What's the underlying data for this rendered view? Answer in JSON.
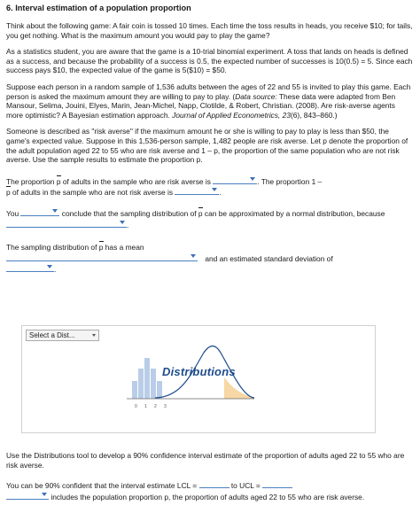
{
  "title": "6. Interval estimation of a population proportion",
  "para1": "Think about the following game: A fair coin is tossed 10 times. Each time the toss results in heads, you receive $10; for tails, you get nothing. What is the maximum amount you would pay to play the game?",
  "para2": "As a statistics student, you are aware that the game is a 10-trial binomial experiment. A toss that lands on heads is defined as a success, and because the probability of a success is 0.5, the expected number of successes is 10(0.5) = 5. Since each success pays $10, the expected value of the game is 5($10) = $50.",
  "para3a": "Suppose each person in a random sample of 1,536 adults between the ages of 22 and 55 is invited to play this game. Each person is asked the maximum amount they are willing to pay to play. (",
  "para3_source_label": "Data source:",
  "para3b": " These data were adapted from Ben Mansour, Selima, Jouini, Elyes, Marin, Jean-Michel, Napp, Clotilde, & Robert, Christian. (2008). Are risk-averse agents more optimistic? A Bayesian estimation approach. ",
  "para3_journal": "Journal of Applied Econometrics, 23",
  "para3c": "(6), 843–860.)",
  "para4": "Someone is described as \"risk averse\" if the maximum amount he or she is willing to pay to play is less than $50, the game's expected value. Suppose in this 1,536-person sample, 1,482 people are risk averse. Let p denote the proportion of the adult population aged 22 to 55 who are risk averse and 1 – p, the proportion of the same population who are not risk averse. Use the sample results to estimate the proportion p.",
  "q1_a": "The proportion",
  "q1_b": "of adults in the sample who are risk averse is",
  "q1_c": ". The proportion 1 –",
  "q1_d": "of adults in the sample who are not risk averse is",
  "q1_e": ".",
  "q2_a": "You",
  "q2_b": "conclude that the sampling distribution of",
  "q2_c": "can be approximated by a normal distribution, because",
  "q2_d": ".",
  "q3_a": "The sampling distribution of",
  "q3_b": "has a mean",
  "q3_c": "and an estimated standard deviation of",
  "q3_d": ".",
  "phat": "p",
  "tool": {
    "select_label": "Select a Dist...",
    "title": "Distributions",
    "axis_ticks": [
      "0",
      "1",
      "2",
      "3"
    ]
  },
  "para5": "Use the Distributions tool to develop a 90% confidence interval estimate of the proportion of adults aged 22 to 55 who are risk averse.",
  "q4_a": "You can be 90% confident that the interval estimate LCL =",
  "q4_b": "to UCL =",
  "q4_c": "includes the population proportion p, the proportion of adults aged 22 to 55 who are risk averse.",
  "colors": {
    "accent": "#3f6fb5",
    "bars": "#b9cde8",
    "curve": "#1e4c8c",
    "tail": "#f7d7a6"
  }
}
